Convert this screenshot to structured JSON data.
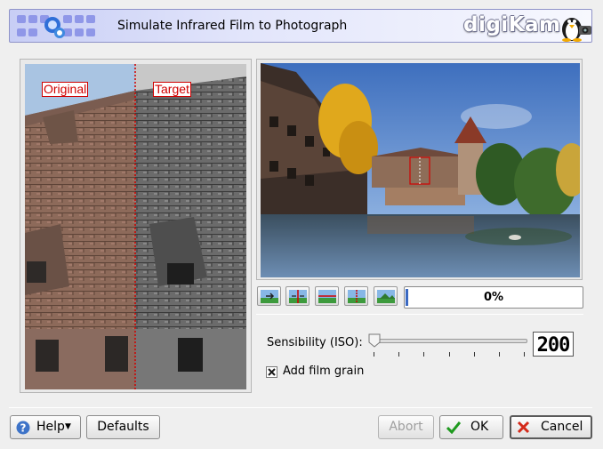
{
  "header": {
    "title": "Simulate Infrared Film to Photograph",
    "brand": "digiKam"
  },
  "preview": {
    "original_label": "Original",
    "target_label": "Target"
  },
  "progress": {
    "text": "0%",
    "value": 0
  },
  "settings": {
    "sensibility_label": "Sensibility (ISO):",
    "sensibility_value": "200",
    "slider_fraction": 0.0,
    "film_grain_label": "Add film grain",
    "film_grain_checked": true
  },
  "buttons": {
    "help": "Help",
    "defaults": "Defaults",
    "abort": "Abort",
    "ok": "OK",
    "cancel": "Cancel"
  },
  "colors": {
    "accent": "#3a69c2",
    "marker_red": "#d00000"
  }
}
